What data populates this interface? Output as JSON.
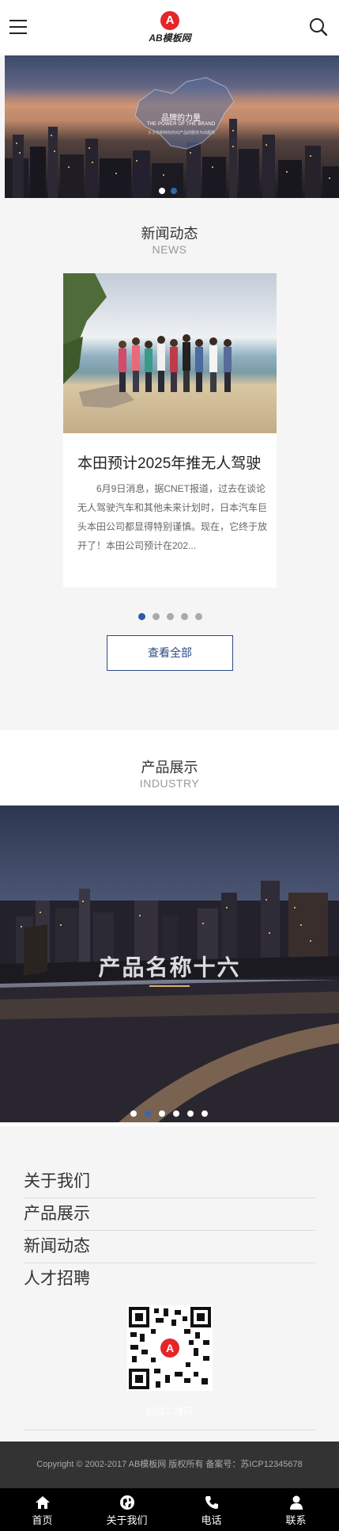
{
  "header": {
    "menu_icon": "hamburger-menu-icon",
    "logo_letter": "A",
    "logo_text": "AB模板网",
    "search_icon": "search-icon"
  },
  "banner": {
    "title": "品牌的力量",
    "subtitle": "THE POWER OF THE BRAND",
    "caption": "5.子份和特份的出产品的服务为出服务",
    "slides": 2,
    "active_slide": 1
  },
  "news": {
    "title": "新闻动态",
    "subtitle": "NEWS",
    "article": {
      "title": "本田预计2025年推无人驾驶",
      "summary": "6月9日消息，据CNET报道，过去在谈论无人驾驶汽车和其他未来计划时，日本汽车巨头本田公司都显得特别谨慎。现在，它终于放开了！本田公司预计在202..."
    },
    "pager_count": 5,
    "pager_active": 1,
    "view_all": "查看全部"
  },
  "products": {
    "title": "产品展示",
    "subtitle": "INDUSTRY",
    "current_name": "产品名称十六",
    "pager_count": 6,
    "pager_active": 2
  },
  "footer": {
    "links": [
      "关于我们",
      "产品展示",
      "新闻动态",
      "人才招聘"
    ],
    "qr_logo_letter": "A",
    "qr_caption": "扫描二维码",
    "copyright": "Copyright © 2002-2017 AB模板网 版权所有 备案号：苏ICP12345678"
  },
  "tabbar": [
    {
      "label": "首页",
      "icon": "home-icon"
    },
    {
      "label": "关于我们",
      "icon": "globe-icon"
    },
    {
      "label": "电话",
      "icon": "phone-icon"
    },
    {
      "label": "联系",
      "icon": "user-icon"
    }
  ],
  "colors": {
    "accent": "#2e5aa8",
    "logo_red": "#e5252a",
    "footer_dark": "#333333",
    "tabbar": "#000000"
  }
}
